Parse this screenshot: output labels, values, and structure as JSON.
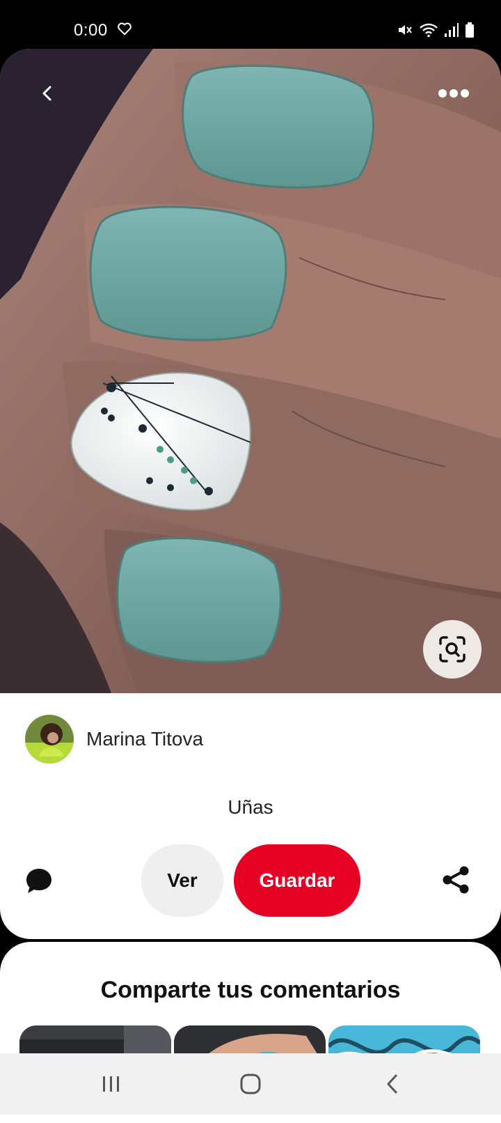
{
  "status_bar": {
    "time": "0:00"
  },
  "pin": {
    "image_description_icon": "nail-art-photo",
    "author": {
      "name": "Marina Titova"
    },
    "title": "Uñas",
    "actions": {
      "view_label": "Ver",
      "save_label": "Guardar"
    }
  },
  "comments": {
    "title": "Comparte tus comentarios"
  },
  "colors": {
    "save_red": "#e60023",
    "ver_gray": "#efefef"
  },
  "icons": [
    "heart-icon",
    "mute-icon",
    "wifi-icon",
    "signal-icon",
    "battery-icon",
    "back-icon",
    "more-icon",
    "visual-search-icon",
    "comment-icon",
    "share-icon",
    "recent-apps-icon",
    "home-icon",
    "nav-back-icon"
  ]
}
